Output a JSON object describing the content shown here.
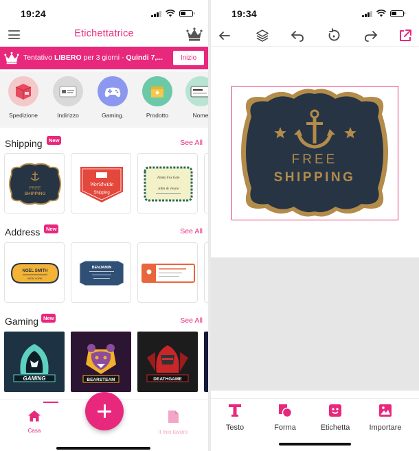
{
  "left_screen": {
    "status": {
      "time": "19:24"
    },
    "header": {
      "title": "Etichettatrice"
    },
    "promo": {
      "prefix": "Tentativo ",
      "bold": "LIBERO",
      "middle": " per 3 giorni - ",
      "bold2": "Quindi 7,...",
      "button": "Inizio"
    },
    "categories": [
      {
        "label": "Spedizione",
        "color": "#f4c9c9"
      },
      {
        "label": "Indirizzo",
        "color": "#d9d9d9"
      },
      {
        "label": "Gaming.",
        "color": "#8c98f0"
      },
      {
        "label": "Prodotto",
        "color": "#6bc9a8"
      },
      {
        "label": "Nome",
        "color": "#b9e4d4"
      }
    ],
    "sections": [
      {
        "title": "Shipping",
        "badge": "New",
        "see_all": "See All"
      },
      {
        "title": "Address",
        "badge": "New",
        "see_all": "See All"
      },
      {
        "title": "Gaming",
        "badge": "New",
        "see_all": "See All"
      }
    ],
    "shipping_cards": [
      {
        "line1": "FREE",
        "line2": "SHIPPING"
      },
      {
        "line1": "Worldwide",
        "line2": "Shipping"
      },
      {
        "line1": "Jimmy Fox Gate",
        "line2": "John & Jessie"
      }
    ],
    "address_cards": [
      {
        "line1": "NOEL SMITH",
        "line2": "NEW YORK"
      },
      {
        "line1": "BENJAMIN",
        "line2": ""
      },
      {
        "line1": "",
        "line2": ""
      }
    ],
    "gaming_cards": [
      {
        "label": "GAMING"
      },
      {
        "label": "BEARSTEAM"
      },
      {
        "label": "DEATHGAME"
      }
    ],
    "nav": {
      "home": "Casa",
      "works": "Il mio lavoro"
    }
  },
  "right_screen": {
    "status": {
      "time": "19:34"
    },
    "canvas": {
      "line1": "FREE",
      "line2": "SHIPPING"
    },
    "tabs": [
      {
        "label": "Testo"
      },
      {
        "label": "Forma"
      },
      {
        "label": "Etichetta"
      },
      {
        "label": "Importare"
      }
    ]
  },
  "colors": {
    "accent": "#e8287c",
    "label_navy": "#263444",
    "label_gold": "#b38b4a"
  },
  "icons": [
    "menu-icon",
    "crown-icon",
    "back-arrow-icon",
    "layers-icon",
    "undo-icon",
    "rotate-icon",
    "redo-icon",
    "share-icon",
    "home-icon",
    "document-icon",
    "plus-icon"
  ]
}
